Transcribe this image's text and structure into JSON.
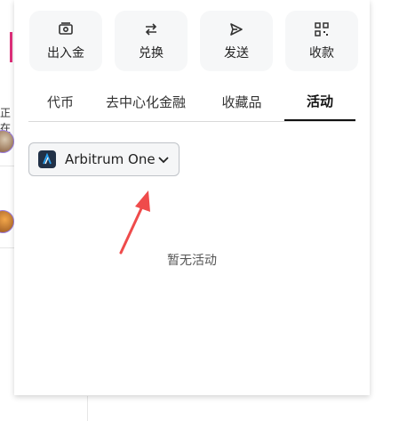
{
  "actions": [
    {
      "label": "出入金",
      "icon": "wallet-icon"
    },
    {
      "label": "兑换",
      "icon": "swap-icon"
    },
    {
      "label": "发送",
      "icon": "send-icon"
    },
    {
      "label": "收款",
      "icon": "qr-code-icon"
    }
  ],
  "tabs": [
    {
      "label": "代币",
      "active": false
    },
    {
      "label": "去中心化金融",
      "active": false
    },
    {
      "label": "收藏品",
      "active": false
    },
    {
      "label": "活动",
      "active": true
    }
  ],
  "network": {
    "name": "Arbitrum One",
    "icon": "arbitrum-logo-icon"
  },
  "activity": {
    "empty_text": "暂无活动"
  },
  "background": {
    "partial_text": "正在"
  },
  "colors": {
    "annotation_arrow": "#ef4b4b",
    "active_tab": "#111111"
  }
}
